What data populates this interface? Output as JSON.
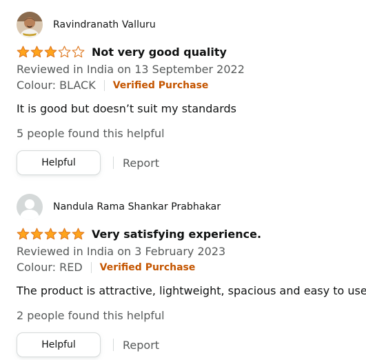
{
  "reviews": [
    {
      "reviewer_name": "Ravindranath Valluru",
      "avatar": "user-photo",
      "rating": 3,
      "max_rating": 5,
      "title": "Not very good quality",
      "date_line": "Reviewed in India on 13 September 2022",
      "colour": "Colour: BLACK",
      "verified": "Verified Purchase",
      "body": "It is good but doesn’t suit my standards",
      "helpful_count": "5 people found this helpful",
      "helpful_label": "Helpful",
      "report_label": "Report"
    },
    {
      "reviewer_name": "Nandula Rama Shankar Prabhakar",
      "avatar": "default-user-icon",
      "rating": 5,
      "max_rating": 5,
      "title": "Very satisfying experience.",
      "date_line": "Reviewed in India on 3 February 2023",
      "colour": "Colour: RED",
      "verified": "Verified Purchase",
      "body": "The product is attractive, lightweight, spacious and easy to use.",
      "helpful_count": "2 people found this helpful",
      "helpful_label": "Helpful",
      "report_label": "Report"
    }
  ],
  "colors": {
    "star_filled": "#ffa41c",
    "star_outline": "#de7921",
    "verified": "#c45500",
    "muted_text": "#565959"
  }
}
